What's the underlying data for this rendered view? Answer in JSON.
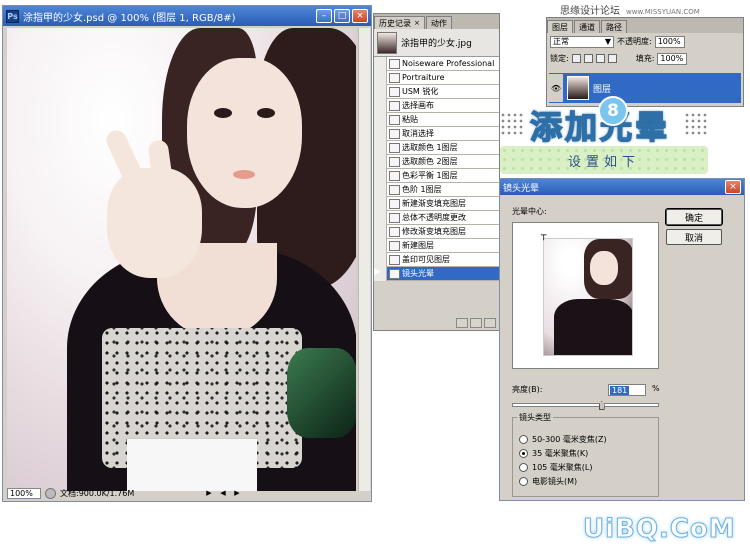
{
  "watermark_top": {
    "text": "思缘设计论坛",
    "site": "www.MISSYUAN.COM"
  },
  "document": {
    "title": "涂指甲的少女.psd @ 100% (图层 1, RGB/8#)",
    "badge": "Ps",
    "zoom": "100%",
    "doc_size": "文档:900.0K/1.76M"
  },
  "history": {
    "tabs": [
      {
        "label": "历史记录"
      },
      {
        "label": "动作"
      }
    ],
    "snapshot_label": "涂指甲的少女.jpg",
    "items": [
      "Noiseware Professional",
      "Portraiture",
      "USM 锐化",
      "选择画布",
      "粘贴",
      "取消选择",
      "选取颜色 1图层",
      "选取颜色 2图层",
      "色彩平衡 1图层",
      "色阶 1图层",
      "新建渐变填充图层",
      "总体不透明度更改",
      "修改渐变填充图层",
      "新建图层",
      "盖印可见图层",
      "镜头光晕"
    ],
    "active_index": 15
  },
  "layers": {
    "tabs": [
      {
        "label": "图层"
      },
      {
        "label": "通道"
      },
      {
        "label": "路径"
      }
    ],
    "blend_mode": "正常",
    "opacity_label": "不透明度:",
    "opacity_value": "100%",
    "lock_label": "锁定:",
    "fill_label": "填充:",
    "fill_value": "100%",
    "layer_name": "图层"
  },
  "banner": {
    "number": "8",
    "title": "添加光晕",
    "subtitle": "设置如下"
  },
  "dialog": {
    "title": "镜头光晕",
    "flare_center_label": "光晕中心:",
    "ok_label": "确定",
    "cancel_label": "取消",
    "brightness_label": "亮度(B):",
    "brightness_value": "181",
    "brightness_unit": "%",
    "brightness_fraction": 0.61,
    "lens_type_label": "镜头类型",
    "lens_options": [
      {
        "label": "50-300 毫米变焦(Z)",
        "selected": false
      },
      {
        "label": "35 毫米聚焦(K)",
        "selected": true
      },
      {
        "label": "105 毫米聚焦(L)",
        "selected": false
      },
      {
        "label": "电影镜头(M)",
        "selected": false
      }
    ]
  },
  "watermark_bottom": "UiBQ.CoM",
  "colors": {
    "titlebar": "#2a5db8",
    "selection": "#316ac5",
    "panel": "#d4d0c8",
    "banner_stroke": "#2e6fa8",
    "banner_sub_bg": "#d9f0c6"
  }
}
